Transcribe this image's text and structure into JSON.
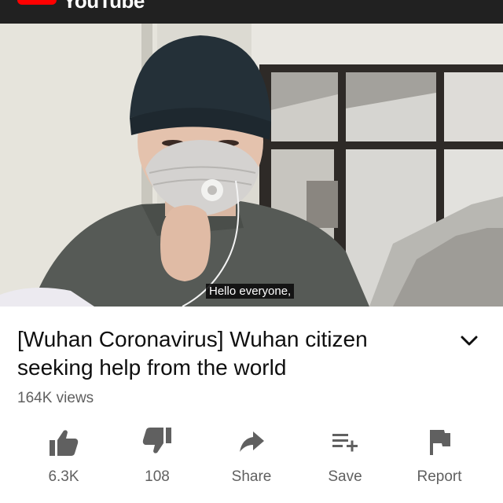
{
  "app": {
    "name": "YouTube",
    "accent": "#ff0000",
    "bar_color": "#212121"
  },
  "video": {
    "caption": "Hello everyone,",
    "title": "[Wuhan Coronavirus] Wuhan citizen seeking help from the world",
    "views": "164K views"
  },
  "actions": [
    {
      "id": "like",
      "label": "6.3K",
      "icon": "thumbs-up-icon"
    },
    {
      "id": "dislike",
      "label": "108",
      "icon": "thumbs-down-icon"
    },
    {
      "id": "share",
      "label": "Share",
      "icon": "share-icon"
    },
    {
      "id": "save",
      "label": "Save",
      "icon": "add-to-playlist-icon"
    },
    {
      "id": "report",
      "label": "Report",
      "icon": "flag-icon"
    }
  ]
}
